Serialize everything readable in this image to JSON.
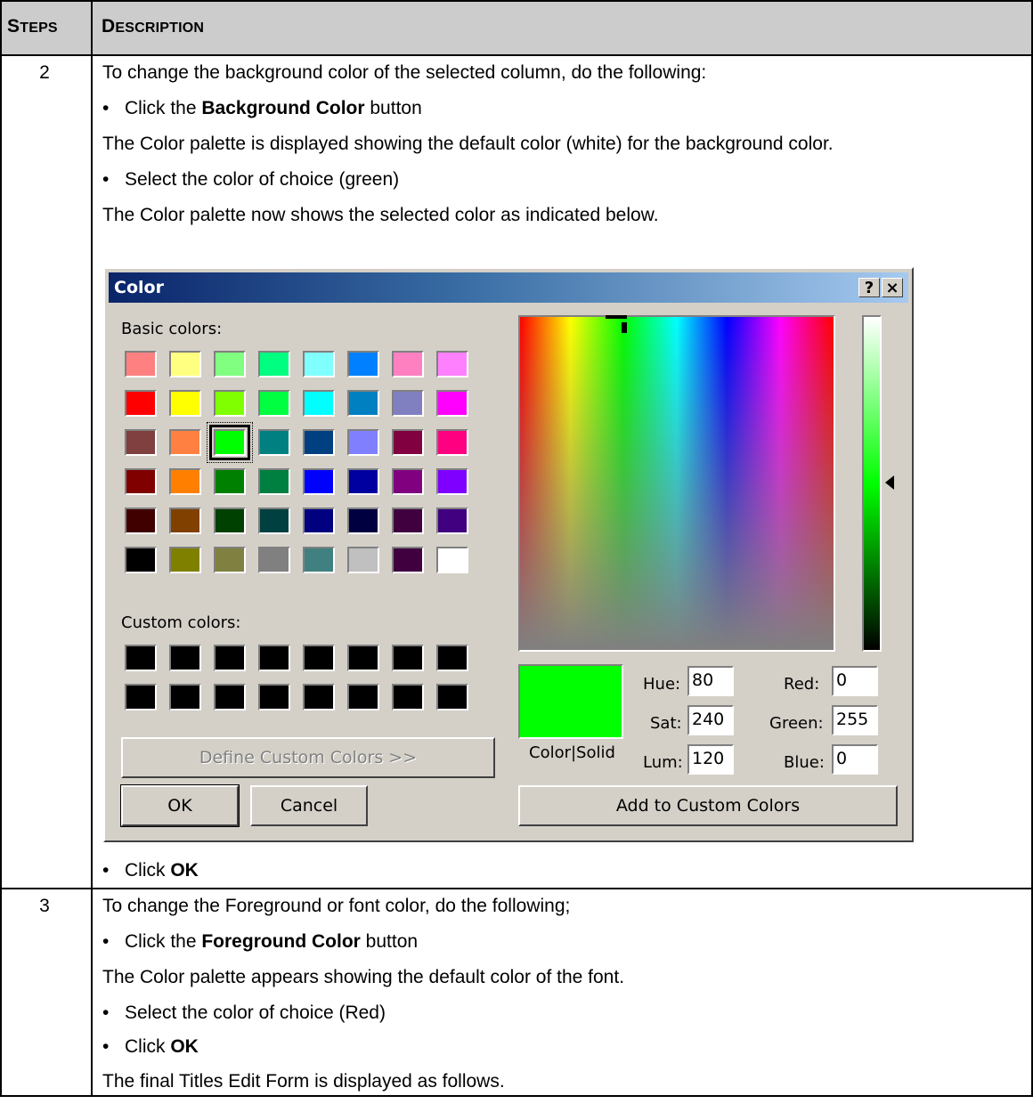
{
  "table": {
    "header": {
      "steps_first": "S",
      "steps_rest": "TEPS",
      "desc_first": "D",
      "desc_rest": "ESCRIPTION"
    },
    "rows": [
      {
        "step": "2",
        "lines": [
          "To change the background color of the selected column, do the following:",
          "Click the ",
          "Background Color",
          " button",
          "The Color palette is displayed showing the default color (white) for the background color.",
          "Select the color of choice (green)",
          "The Color palette now shows the selected color as indicated below.",
          "Click ",
          "OK"
        ]
      },
      {
        "step": "3",
        "lines": [
          "To change the Foreground or font color, do the following;",
          "Click the ",
          "Foreground Color",
          " button",
          "The Color palette appears showing the default color of the font.",
          "Select the color of choice (Red)",
          "Click ",
          "OK",
          "The final Titles Edit Form is displayed as follows."
        ]
      }
    ]
  },
  "dialog": {
    "title": "Color",
    "help_label": "?",
    "close_label": "×",
    "basic_colors_label": "Basic colors:",
    "custom_colors_label": "Custom colors:",
    "define_custom_label": "Define Custom Colors >>",
    "ok_label": "OK",
    "cancel_label": "Cancel",
    "add_custom_label": "Add to Custom Colors",
    "color_solid_label": "Color|Solid",
    "hue_label": "Hue:",
    "sat_label": "Sat:",
    "lum_label": "Lum:",
    "red_label": "Red:",
    "green_label": "Green:",
    "blue_label": "Blue:",
    "hue": "80",
    "sat": "240",
    "lum": "120",
    "red": "0",
    "green": "255",
    "blue": "0",
    "selected_color": "#00ff00",
    "selected_swatch_index": 18,
    "basic_colors": [
      "#ff8080",
      "#ffff80",
      "#80ff80",
      "#00ff80",
      "#80ffff",
      "#0080ff",
      "#ff80c0",
      "#ff80ff",
      "#ff0000",
      "#ffff00",
      "#80ff00",
      "#00ff40",
      "#00ffff",
      "#0080c0",
      "#8080c0",
      "#ff00ff",
      "#804040",
      "#ff8040",
      "#00ff00",
      "#008080",
      "#004080",
      "#8080ff",
      "#800040",
      "#ff0080",
      "#800000",
      "#ff8000",
      "#008000",
      "#008040",
      "#0000ff",
      "#0000a0",
      "#800080",
      "#8000ff",
      "#400000",
      "#804000",
      "#004000",
      "#004040",
      "#000080",
      "#000040",
      "#400040",
      "#400080",
      "#000000",
      "#808000",
      "#808040",
      "#808080",
      "#408080",
      "#c0c0c0",
      "#400040",
      "#ffffff"
    ],
    "custom_colors": [
      "#000000",
      "#000000",
      "#000000",
      "#000000",
      "#000000",
      "#000000",
      "#000000",
      "#000000",
      "#000000",
      "#000000",
      "#000000",
      "#000000",
      "#000000",
      "#000000",
      "#000000",
      "#000000"
    ]
  }
}
